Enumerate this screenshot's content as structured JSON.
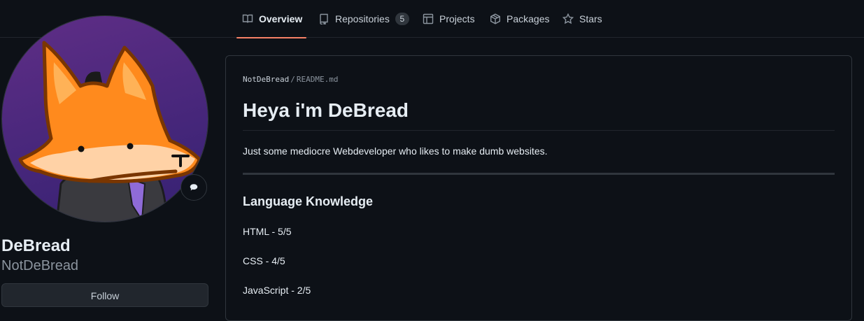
{
  "nav": {
    "tabs": [
      {
        "label": "Overview",
        "icon": "book-icon"
      },
      {
        "label": "Repositories",
        "icon": "repo-icon",
        "count": "5"
      },
      {
        "label": "Projects",
        "icon": "table-icon"
      },
      {
        "label": "Packages",
        "icon": "package-icon"
      },
      {
        "label": "Stars",
        "icon": "star-icon"
      }
    ],
    "accent": "#f78166"
  },
  "profile": {
    "name": "DeBread",
    "login": "NotDeBread",
    "follow_label": "Follow",
    "status_icon": "speech-bubble-icon"
  },
  "readme": {
    "owner": "NotDeBread",
    "separator": "/",
    "file": "README.md",
    "heading": "Heya i'm DeBread",
    "intro": "Just some mediocre Webdeveloper who likes to make dumb websites.",
    "section_title": "Language Knowledge",
    "languages": [
      "HTML - 5/5",
      "CSS - 4/5",
      "JavaScript - 2/5"
    ]
  },
  "colors": {
    "background": "#0d1117",
    "border": "#30363d",
    "text": "#c9d1d9",
    "muted": "#8b949e"
  }
}
